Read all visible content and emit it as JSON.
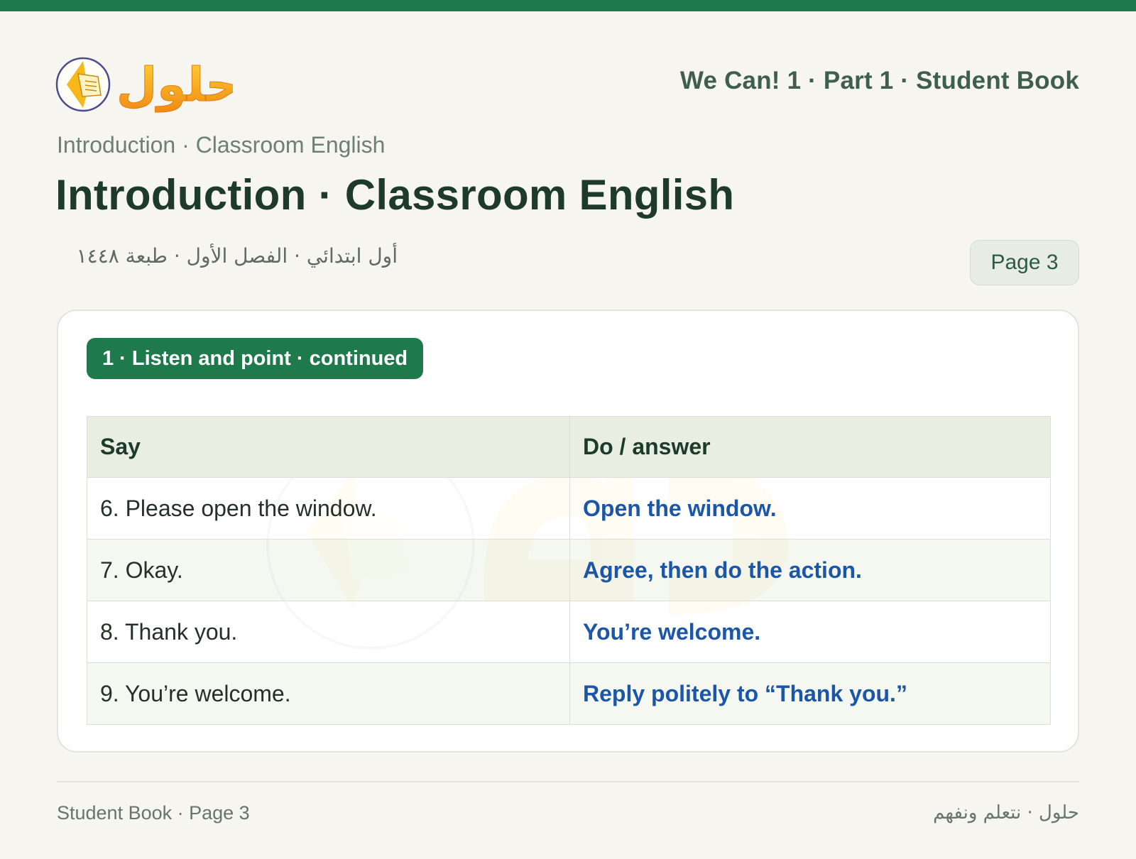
{
  "header": {
    "logo_text": "حلول",
    "book_title": "We Can! 1 · Part 1 · Student Book"
  },
  "breadcrumb": "Introduction · Classroom English",
  "page_title": "Introduction · Classroom English",
  "arabic_meta": "أول ابتدائي · الفصل الأول · طبعة ١٤٤٨",
  "page_badge": "Page 3",
  "section": {
    "tag": "1 · Listen and point · continued",
    "columns": [
      "Say",
      "Do / answer"
    ],
    "rows": [
      {
        "say": "6. Please open the window.",
        "answer": "Open the window."
      },
      {
        "say": "7. Okay.",
        "answer": "Agree, then do the action."
      },
      {
        "say": "8. Thank you.",
        "answer": "You’re welcome."
      },
      {
        "say": "9. You’re welcome.",
        "answer": "Reply politely to “Thank you.”"
      }
    ]
  },
  "footer": {
    "left": "Student Book · Page 3",
    "right": "حلول · نتعلم ونفهم"
  },
  "colors": {
    "brand_green": "#1e7a4c",
    "answer_blue": "#1c56a8",
    "logo_orange": "#f0a020"
  }
}
